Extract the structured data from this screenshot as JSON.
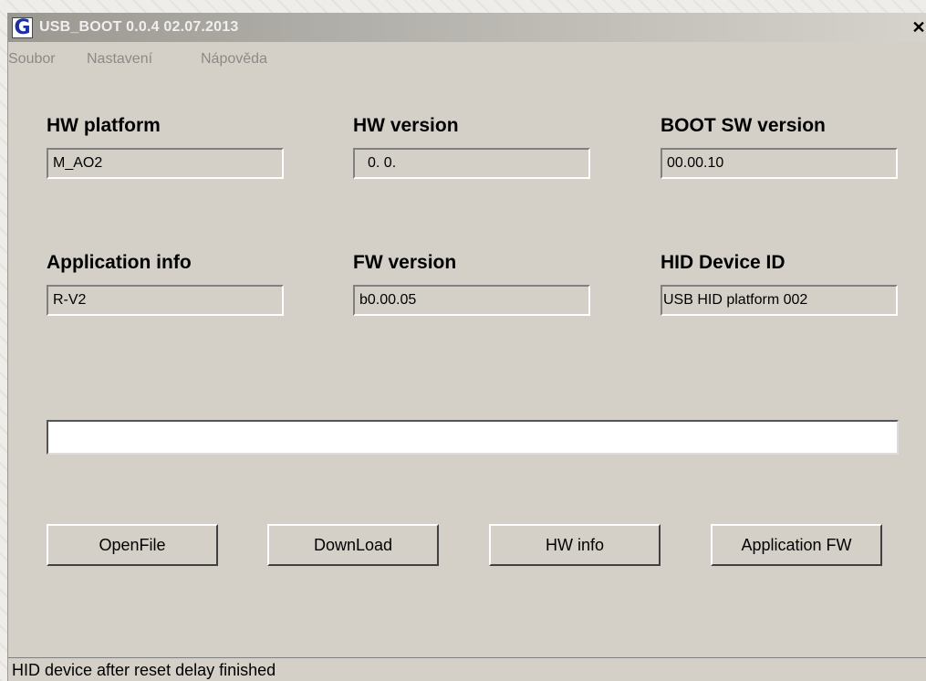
{
  "window": {
    "title": "USB_BOOT  0.0.4 02.07.2013",
    "icon": "G",
    "close_glyph": "✕"
  },
  "menu": {
    "items": [
      "Soubor",
      "Nastavení",
      "Nápověda"
    ]
  },
  "fields": {
    "hw_platform": {
      "label": "HW platform",
      "value": "M_AO2"
    },
    "hw_version": {
      "label": "HW version",
      "value": "0. 0."
    },
    "boot_sw": {
      "label": "BOOT SW version",
      "value": "00.00.10"
    },
    "app_info": {
      "label": "Application info",
      "value": "R-V2"
    },
    "fw_version": {
      "label": "FW version",
      "value": "b0.00.05"
    },
    "hid_device": {
      "label": "HID Device ID",
      "value": "USB HID platform 002"
    }
  },
  "progress": {
    "percent": 0
  },
  "buttons": {
    "open_file": "OpenFile",
    "download": "DownLoad",
    "hw_info": "HW info",
    "application_fw": "Application FW"
  },
  "status": {
    "text": "HID device after reset delay finished"
  },
  "colors": {
    "title_gradient_start": "#9a9890",
    "window_face": "#d4d0c8",
    "icon_blue": "#1a2fa8"
  }
}
